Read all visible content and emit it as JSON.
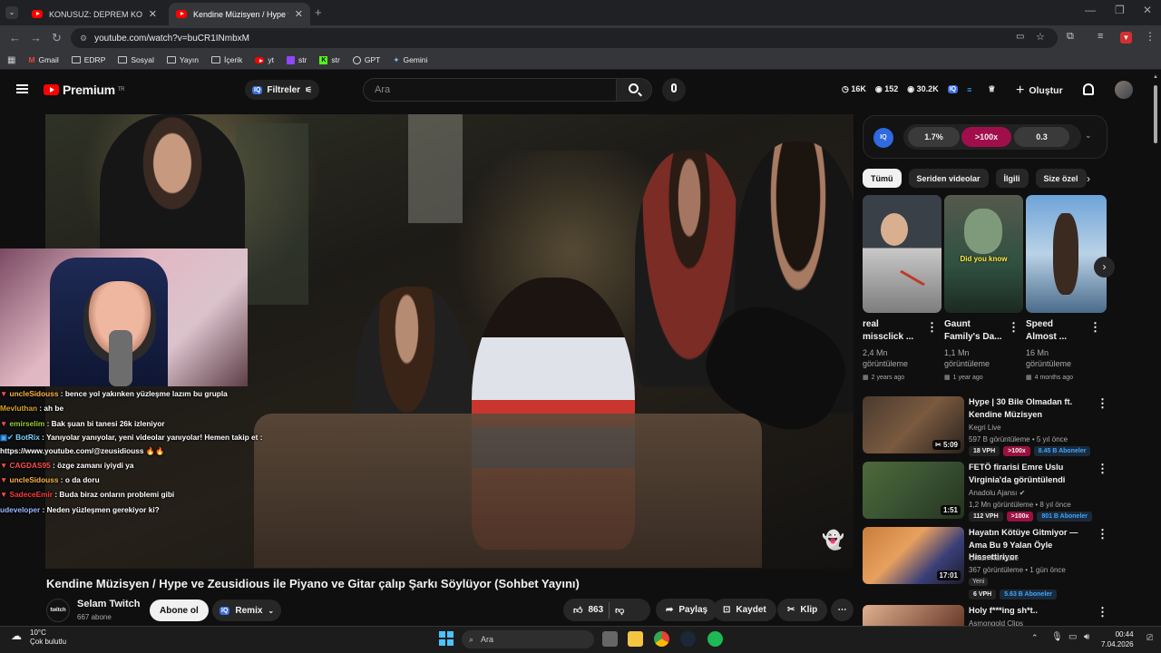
{
  "browser": {
    "tabs": [
      {
        "title": "KONUSUZ: DEPREM KORKUM, İ"
      },
      {
        "title": "Kendine Müzisyen / Hype ve Ze"
      }
    ],
    "url": "youtube.com/watch?v=buCR1INmbxM",
    "bookmarks": [
      "Gmail",
      "EDRP",
      "Sosyal",
      "Yayın",
      "İçerik",
      "yt",
      "str",
      "str",
      "GPT",
      "Gemini"
    ]
  },
  "header": {
    "logo": "Premium",
    "region": "TR",
    "filter_label": "Filtreler",
    "search_placeholder": "Ara",
    "stats": [
      "16K",
      "152",
      "30.2K"
    ],
    "create_label": "Oluştur"
  },
  "chat": [
    {
      "user": "uncleSidouss",
      "text": ": bence yol yakınken yüzleşme lazım bu grupla",
      "color": "#ffb347"
    },
    {
      "user": "Mevluthan",
      "text": ": ah be",
      "color": "#daa520"
    },
    {
      "user": "emirselim",
      "text": ": Bak şuan bi tanesi 26k izleniyor",
      "color": "#9acd32"
    },
    {
      "user": "BotRix",
      "text": ": Yanıyolar yanıyolar, yeni videolar yanıyolar! Hemen takip et : https://www.youtube.com/@zeusidiouss 🔥🔥",
      "color": "#7fd4ff"
    },
    {
      "user": "CAGDAS95",
      "text": ": özge zamanı iyiydi ya",
      "color": "#ff4d4d"
    },
    {
      "user": "uncleSidouss",
      "text": ": o da doru",
      "color": "#ffb347"
    },
    {
      "user": "SadeceEmir",
      "text": ": Buda biraz onların problemi gibi",
      "color": "#ff3b3b"
    },
    {
      "user": "udeveloper",
      "text": ": Neden yüzleşmen gerekiyor ki?",
      "color": "#9ab8ff"
    }
  ],
  "video": {
    "title": "Kendine Müzisyen / Hype ve Zeusidious ile Piyano ve Gitar çalıp Şarkı Söylüyor (Sohbet Yayını)",
    "channel_logo": "twitch",
    "channel": "Selam Twitch",
    "subs": "667 abone",
    "subscribe": "Abone ol",
    "remix": "Remix",
    "likes": "863",
    "share": "Paylaş",
    "save": "Kaydet",
    "clip": "Klip"
  },
  "iq_panel": {
    "values": [
      "1.7%",
      ">100x",
      "0.3"
    ]
  },
  "chips": [
    "Tümü",
    "Seriden videolar",
    "İlgili",
    "Size özel"
  ],
  "shorts": [
    {
      "title": "real missclick ...",
      "views": "2,4 Mn görüntüleme",
      "age": "2 years ago"
    },
    {
      "title": "Gaunt Family's Da...",
      "views": "1,1 Mn görüntüleme",
      "age": "1 year ago",
      "overlay": "Did you know"
    },
    {
      "title": "Speed Almost ...",
      "views": "16 Mn görüntüleme",
      "age": "4 months ago"
    }
  ],
  "related": [
    {
      "title": "Hype | 30 Bile Olmadan ft. Kendine Müzisyen",
      "channel": "Kegri Live",
      "meta": "597 B görüntüleme • 5 yıl önce",
      "duration": "5:09",
      "vph": "18 VPH",
      "mult": ">100x",
      "subs": "8.45 B Aboneler"
    },
    {
      "title": "FETÖ firarisi Emre Uslu Virginia'da görüntülendi",
      "channel": "Anadolu Ajansı",
      "meta": "1,2 Mn görüntüleme • 8 yıl önce",
      "duration": "1:51",
      "vph": "112 VPH",
      "mult": ">100x",
      "subs": "801 B Aboneler"
    },
    {
      "title": "Hayatın Kötüye Gitmiyor — Ama Bu 9 Yalan Öyle Hissettiriyor",
      "channel": "Orkun Kumkale",
      "meta": "367 görüntüleme • 1 gün önce",
      "tag": "Yeni",
      "duration": "17:01",
      "vph": "6 VPH",
      "subs": "5.63 B Aboneler"
    },
    {
      "title": "Holy f***ing sh*t..",
      "channel": "Asmongold Clips"
    }
  ],
  "taskbar": {
    "temp": "10°C",
    "weather": "Çok bulutlu",
    "search": "Ara",
    "time": "00:44",
    "date": "7.04.2026"
  }
}
